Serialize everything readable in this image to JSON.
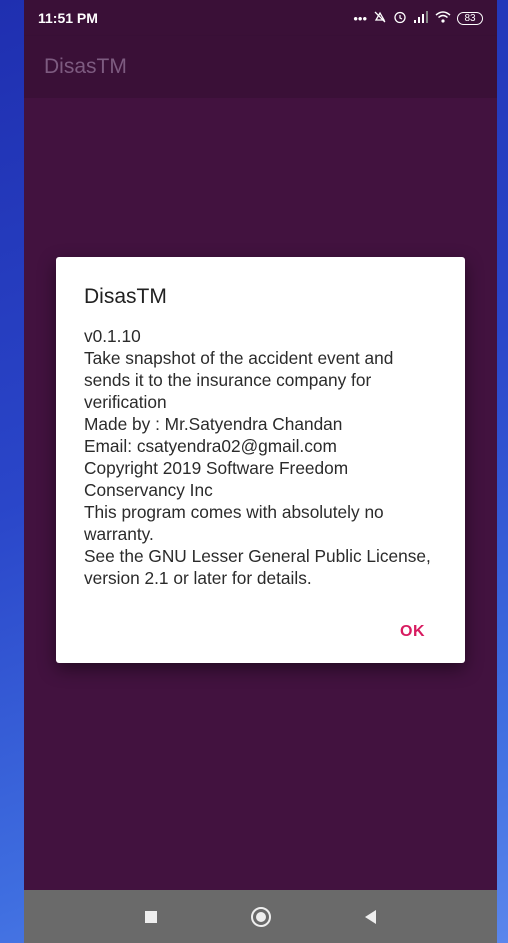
{
  "status": {
    "time": "11:51 PM",
    "icons": [
      "dots-icon",
      "mute-icon",
      "alarm-icon",
      "signal-icon",
      "wifi-icon"
    ],
    "battery": "83"
  },
  "app": {
    "title": "DisasTM"
  },
  "dialog": {
    "title": "DisasTM",
    "lines": [
      "v0.1.10",
      "Take snapshot of the accident event and sends it to the insurance company for verification",
      "Made by : Mr.Satyendra Chandan",
      "Email: csatyendra02@gmail.com",
      "Copyright 2019 Software Freedom Conservancy Inc",
      "This program comes with absolutely no warranty.",
      "See the GNU Lesser General Public License, version 2.1 or later for details."
    ],
    "ok_label": "OK"
  },
  "colors": {
    "app_background": "#42123f",
    "app_bar": "#3a1037",
    "accent": "#d81b60",
    "nav_bar": "#6a6a6a"
  }
}
